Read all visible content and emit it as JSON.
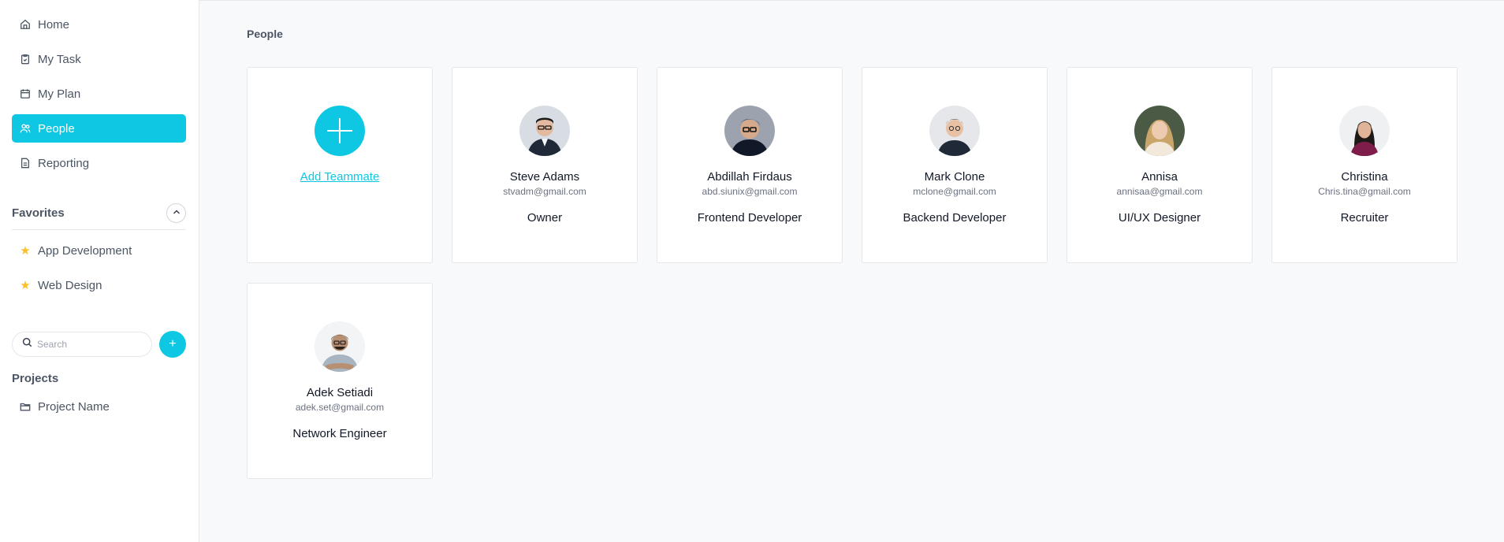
{
  "sidebar": {
    "nav": [
      {
        "label": "Home",
        "icon": "home-icon"
      },
      {
        "label": "My Task",
        "icon": "clipboard-icon"
      },
      {
        "label": "My Plan",
        "icon": "calendar-icon"
      },
      {
        "label": "People",
        "icon": "people-icon",
        "active": true
      },
      {
        "label": "Reporting",
        "icon": "document-icon"
      }
    ],
    "favorites_title": "Favorites",
    "favorites": [
      {
        "label": "App Development"
      },
      {
        "label": "Web Design"
      }
    ],
    "search_placeholder": "Search",
    "projects_title": "Projects",
    "projects": [
      {
        "label": "Project Name"
      }
    ]
  },
  "main": {
    "title": "People",
    "add_label": "Add Teammate",
    "people": [
      {
        "name": "Steve Adams",
        "email": "stvadm@gmail.com",
        "role": "Owner"
      },
      {
        "name": "Abdillah Firdaus",
        "email": "abd.siunix@gmail.com",
        "role": "Frontend Developer"
      },
      {
        "name": "Mark Clone",
        "email": "mclone@gmail.com",
        "role": "Backend Developer"
      },
      {
        "name": "Annisa",
        "email": "annisaa@gmail.com",
        "role": "UI/UX Designer"
      },
      {
        "name": "Christina",
        "email": "Chris.tina@gmail.com",
        "role": "Recruiter"
      },
      {
        "name": "Adek Setiadi",
        "email": "adek.set@gmail.com",
        "role": "Network Engineer"
      }
    ]
  },
  "colors": {
    "accent": "#0ec8e3",
    "star": "#fbbf24"
  }
}
